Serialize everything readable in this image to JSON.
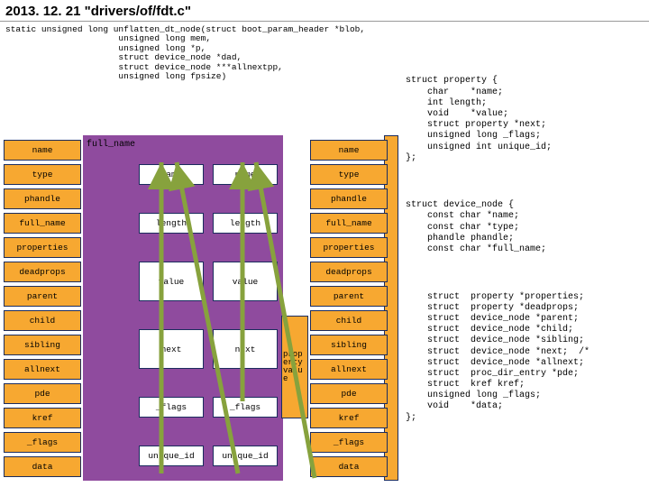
{
  "title": "2013. 12. 21 \"drivers/of/fdt.c\"",
  "signature": "static unsigned long unflatten_dt_node(struct boot_param_header *blob,\n                      unsigned long mem,\n                      unsigned long *p,\n                      struct device_node *dad,\n                      struct device_node ***allnextpp,\n                      unsigned long fpsize)",
  "node_fields": [
    "name",
    "type",
    "phandle",
    "full_name",
    "properties",
    "deadprops",
    "parent",
    "child",
    "sibling",
    "allnext",
    "pde",
    "kref",
    "_flags",
    "data"
  ],
  "prop_fields": [
    "name",
    "length",
    "value",
    "next",
    "_flags",
    "unique_id"
  ],
  "fullname_label": "full_name",
  "propvals_text": "property value",
  "struct_property": "struct property {\n    char    *name;\n    int length;\n    void    *value;\n    struct property *next;\n    unsigned long _flags;\n    unsigned int unique_id;\n};",
  "struct_device_node_top": "struct device_node {\n    const char *name;\n    const char *type;\n    phandle phandle;\n    const char *full_name;",
  "struct_device_node_bottom": "    struct  property *properties;\n    struct  property *deadprops;\n    struct  device_node *parent;\n    struct  device_node *child;\n    struct  device_node *sibling;\n    struct  device_node *next;  /*\n    struct  device_node *allnext;\n    struct  proc_dir_entry *pde;\n    struct  kref kref;\n    unsigned long _flags;\n    void    *data;\n};"
}
